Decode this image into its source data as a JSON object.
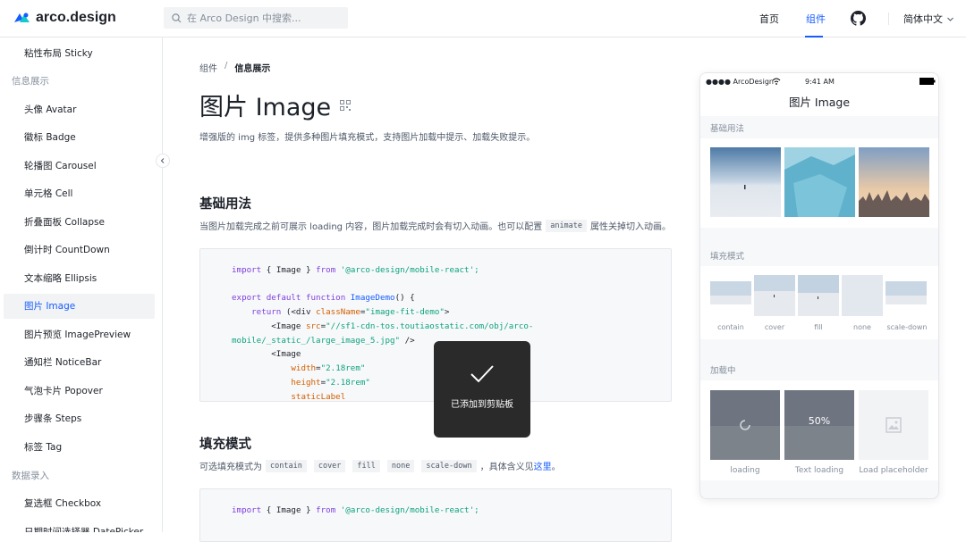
{
  "header": {
    "logo_text": "arco.design",
    "search_placeholder": "在 Arco Design 中搜索...",
    "nav_home": "首页",
    "nav_components": "组件",
    "language": "简体中文"
  },
  "sidebar": {
    "items": [
      {
        "label": "粘性布局 Sticky"
      },
      {
        "group": "信息展示"
      },
      {
        "label": "头像 Avatar"
      },
      {
        "label": "徽标 Badge"
      },
      {
        "label": "轮播图 Carousel"
      },
      {
        "label": "单元格 Cell"
      },
      {
        "label": "折叠面板 Collapse"
      },
      {
        "label": "倒计时 CountDown"
      },
      {
        "label": "文本缩略 Ellipsis"
      },
      {
        "label": "图片 Image",
        "active": true
      },
      {
        "label": "图片预览 ImagePreview"
      },
      {
        "label": "通知栏 NoticeBar"
      },
      {
        "label": "气泡卡片 Popover"
      },
      {
        "label": "步骤条 Steps"
      },
      {
        "label": "标签 Tag"
      },
      {
        "group": "数据录入"
      },
      {
        "label": "复选框 Checkbox"
      },
      {
        "label": "日期时间选择器 DatePicker"
      }
    ]
  },
  "breadcrumb": {
    "parent": "组件",
    "separator": "/",
    "current": "信息展示"
  },
  "page": {
    "title": "图片 Image",
    "description": "增强版的 img 标签，提供多种图片填充模式，支持图片加载中提示、加载失败提示。"
  },
  "section_basic": {
    "title": "基础用法",
    "desc_before": "当图片加载完成之前可展示 loading 内容，图片加载完成时会有切入动画。也可以配置",
    "desc_tag": "animate",
    "desc_after": "属性关掉切入动画。"
  },
  "code1": {
    "l1_kw": "import",
    "l1_a": " { ",
    "l1_name": "Image",
    "l1_b": " } ",
    "l1_from": "from",
    "l1_str": " '@arco-design/mobile-react';",
    "l2_kw": "export default function",
    "l2_fn": " ImageDemo",
    "l2_rest": "() {",
    "l3_kw": "    return",
    "l3_rest": " (<div ",
    "l3_attr": "className",
    "l3_eq": "=",
    "l3_str": "\"image-fit-demo\"",
    "l3_end": ">",
    "l4_a": "        <Image ",
    "l4_attr": "src",
    "l4_eq": "=",
    "l4_str": "\"//sf1-cdn-tos.toutiaostatic.com/obj/arco-",
    "l5_str": "mobile/_static_/large_image_5.jpg\"",
    "l5_end": " />",
    "l6": "        <Image",
    "l7_attr": "            width",
    "l7_eq": "=",
    "l7_str": "\"2.18rem\"",
    "l8_attr": "            height",
    "l8_eq": "=",
    "l8_str": "\"2.18rem\"",
    "l9_attr": "            staticLabel"
  },
  "section_fill": {
    "title": "填充模式",
    "desc_before": "可选填充模式为",
    "tags": [
      "contain",
      "cover",
      "fill",
      "none",
      "scale-down"
    ],
    "desc_after": "，具体含义见",
    "link": "这里",
    "period": "。"
  },
  "code2": {
    "l1_kw": "import",
    "l1_a": " { ",
    "l1_name": "Image",
    "l1_b": " } ",
    "l1_from": "from",
    "l1_str": " '@arco-design/mobile-react';"
  },
  "toast": {
    "text": "已添加到剪贴板"
  },
  "phone": {
    "carrier": "●●●● ArcoDesign",
    "time": "9:41 AM",
    "title": "图片 Image",
    "sections": [
      "基础用法",
      "填充模式",
      "加载中"
    ],
    "fit_labels": [
      "contain",
      "cover",
      "fill",
      "none",
      "scale-down"
    ],
    "loading_labels": [
      "loading",
      "Text loading",
      "Load placeholder"
    ],
    "loading_percent": "50%"
  },
  "colors": {
    "primary": "#165dff",
    "text": "#1d2129",
    "secondary": "#4e5969",
    "muted": "#86909c"
  }
}
